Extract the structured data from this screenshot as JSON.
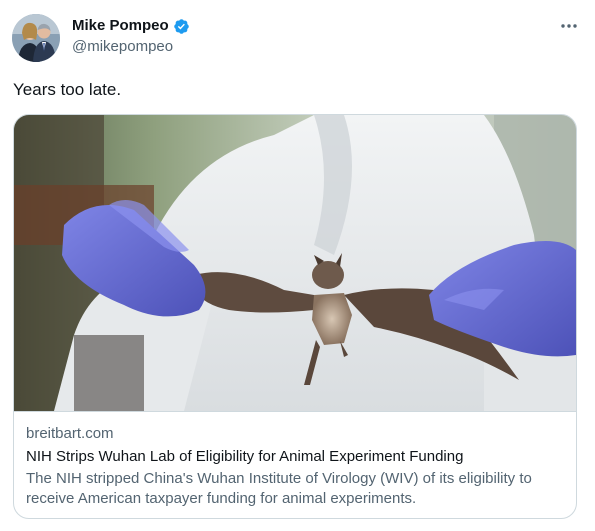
{
  "author": {
    "display_name": "Mike Pompeo",
    "handle": "@mikepompeo",
    "verified": true,
    "verified_color": "#1d9bf0",
    "avatar_icon": "profile-photo-two-people"
  },
  "menu": {
    "icon": "more-horizontal-icon"
  },
  "tweet": {
    "text": "Years too late."
  },
  "card": {
    "image_description_icon": "bat-held-by-gloved-hands-photo",
    "domain": "breitbart.com",
    "title": "NIH Strips Wuhan Lab of Eligibility for Animal Experiment Funding",
    "description": "The NIH stripped China's Wuhan Institute of Virology (WIV) of its eligibility to receive American taxpayer funding for animal experiments."
  },
  "colors": {
    "text_primary": "#0f1419",
    "text_secondary": "#536471",
    "border": "#cfd9de",
    "glove": "#6a6fd8"
  }
}
